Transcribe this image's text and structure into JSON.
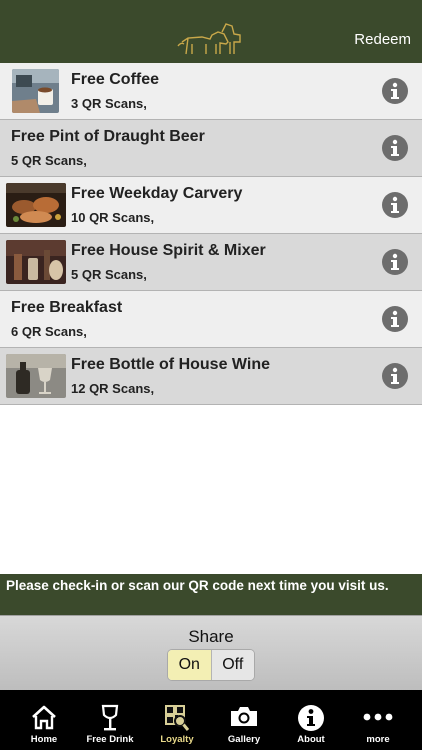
{
  "header": {
    "redeem_label": "Redeem",
    "logo_icon": "cattle-logo-icon"
  },
  "rewards": [
    {
      "title": "Free Coffee",
      "scans": "3 QR Scans,",
      "has_image": true,
      "image": "coffee"
    },
    {
      "title": "Free Pint of Draught Beer",
      "scans": "5 QR Scans,",
      "has_image": false
    },
    {
      "title": "Free Weekday Carvery",
      "scans": "10 QR Scans,",
      "has_image": true,
      "image": "carvery"
    },
    {
      "title": "Free House Spirit & Mixer",
      "scans": "5 QR Scans,",
      "has_image": true,
      "image": "spirit"
    },
    {
      "title": "Free Breakfast",
      "scans": "6 QR Scans,",
      "has_image": false
    },
    {
      "title": "Free Bottle of House Wine",
      "scans": "12 QR Scans,",
      "has_image": true,
      "image": "wine"
    }
  ],
  "banner": {
    "text": "Please check-in or scan our QR code next time you visit us."
  },
  "share": {
    "label": "Share",
    "on_label": "On",
    "off_label": "Off",
    "selected": "On"
  },
  "tabs": [
    {
      "label": "Home",
      "icon": "home-icon"
    },
    {
      "label": "Free Drink",
      "icon": "wine-glass-icon"
    },
    {
      "label": "Loyalty",
      "icon": "qr-search-icon",
      "active": true
    },
    {
      "label": "Gallery",
      "icon": "camera-icon"
    },
    {
      "label": "About",
      "icon": "info-icon"
    },
    {
      "label": "more",
      "icon": "more-dots-icon"
    }
  ],
  "colors": {
    "header_bg": "#3b4a2c",
    "active_tab": "#e8d98a",
    "toggle_on": "#f3efb4"
  }
}
